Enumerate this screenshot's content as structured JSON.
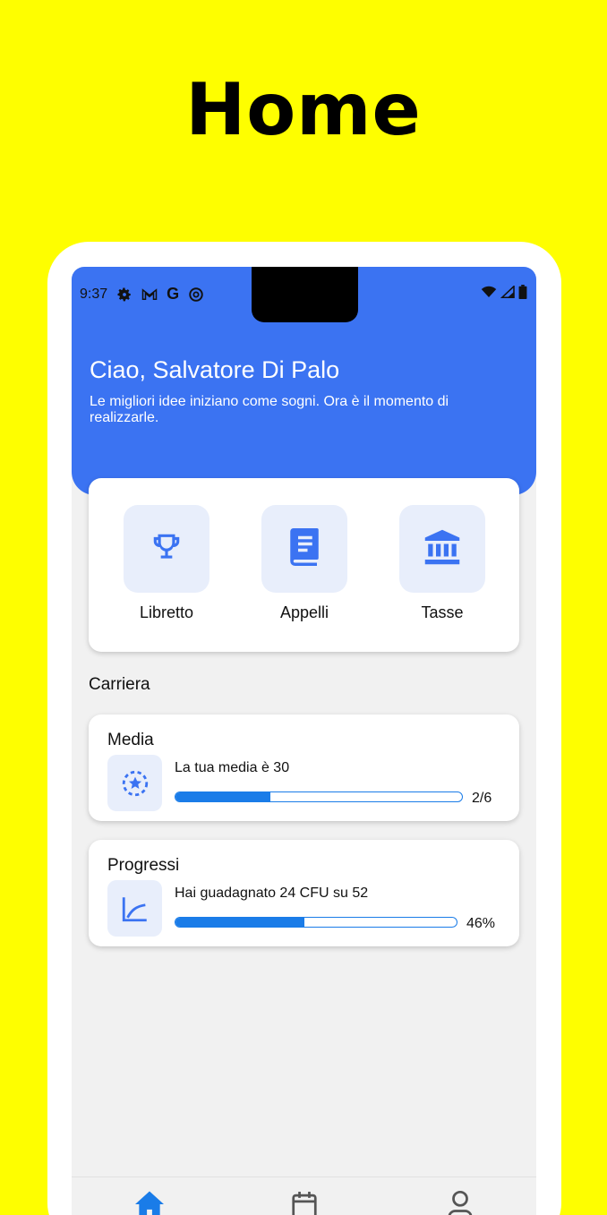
{
  "headline": "Home",
  "status_bar": {
    "time": "9:37",
    "left_icons": [
      "gear-icon",
      "gmail-icon",
      "google-icon",
      "at-icon"
    ],
    "right_icons": [
      "wifi-icon",
      "signal-icon",
      "battery-icon"
    ]
  },
  "header": {
    "greeting": "Ciao, Salvatore Di Palo",
    "subtitle": "Le migliori idee iniziano come sogni. Ora è il momento di realizzarle.",
    "color": "#3b73f2"
  },
  "quick_actions": [
    {
      "label": "Libretto",
      "icon": "trophy-icon"
    },
    {
      "label": "Appelli",
      "icon": "book-icon"
    },
    {
      "label": "Tasse",
      "icon": "bank-icon"
    }
  ],
  "career": {
    "section_title": "Carriera",
    "cards": [
      {
        "title": "Media",
        "text": "La tua media è 30",
        "value_label": "2/6",
        "progress": 0.33,
        "icon": "star-badge-icon"
      },
      {
        "title": "Progressi",
        "text": "Hai guadagnato 24 CFU su 52",
        "value_label": "46%",
        "progress": 0.46,
        "icon": "chart-line-icon"
      }
    ]
  },
  "tabbar": {
    "items": [
      {
        "name": "home",
        "icon": "home-icon",
        "active": true
      },
      {
        "name": "calendar",
        "icon": "calendar-icon",
        "active": false
      },
      {
        "name": "profile",
        "icon": "user-icon",
        "active": false
      }
    ],
    "accent": "#1a7ce8"
  }
}
